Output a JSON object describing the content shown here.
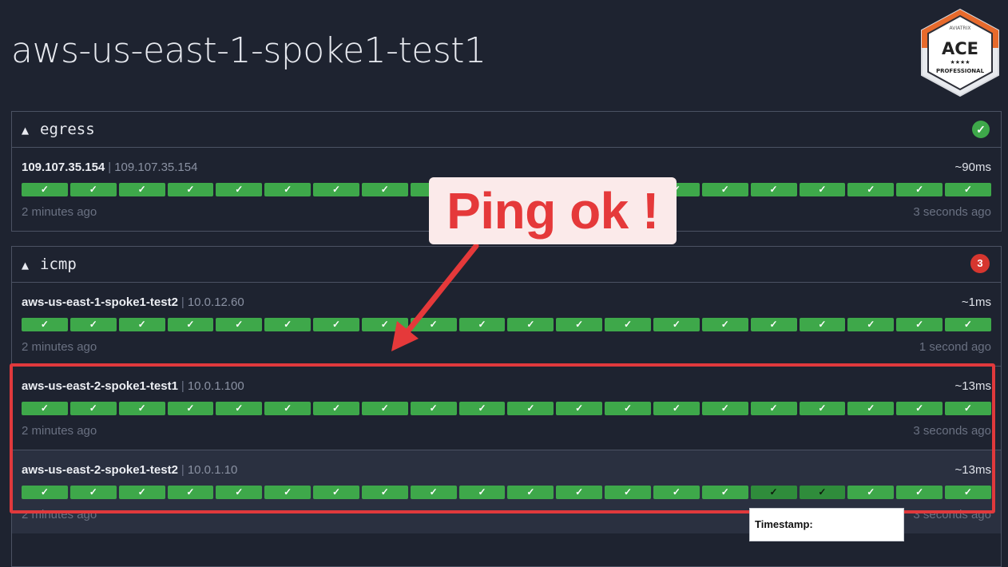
{
  "page": {
    "title": "aws-us-east-1-spoke1-test1"
  },
  "badge": {
    "brand": "AVIATRIX",
    "name": "ACE",
    "stars": "★★★★",
    "level": "PROFESSIONAL"
  },
  "groups": [
    {
      "name": "egress",
      "collapse_icon": "▲",
      "status": "ok",
      "status_icon": "check-circle-icon",
      "status_text": "✓",
      "rows": [
        {
          "name": "109.107.35.154",
          "ip": "109.107.35.154",
          "latency": "~90ms",
          "first_seen": "2 minutes ago",
          "last_seen": "3 seconds ago",
          "checks": [
            "ok",
            "ok",
            "ok",
            "ok",
            "ok",
            "ok",
            "ok",
            "ok",
            "ok",
            "ok",
            "ok",
            "ok",
            "ok",
            "ok",
            "ok",
            "ok",
            "ok",
            "ok",
            "ok",
            "ok"
          ]
        }
      ]
    },
    {
      "name": "icmp",
      "collapse_icon": "▲",
      "status": "count",
      "status_count": "3",
      "rows": [
        {
          "name": "aws-us-east-1-spoke1-test2",
          "ip": "10.0.12.60",
          "latency": "~1ms",
          "first_seen": "2 minutes ago",
          "last_seen": "1 second ago",
          "checks": [
            "ok",
            "ok",
            "ok",
            "ok",
            "ok",
            "ok",
            "ok",
            "ok",
            "ok",
            "ok",
            "ok",
            "ok",
            "ok",
            "ok",
            "ok",
            "ok",
            "ok",
            "ok",
            "ok",
            "ok"
          ]
        },
        {
          "name": "aws-us-east-2-spoke1-test1",
          "ip": "10.0.1.100",
          "latency": "~13ms",
          "first_seen": "2 minutes ago",
          "last_seen": "3 seconds ago",
          "checks": [
            "ok",
            "ok",
            "ok",
            "ok",
            "ok",
            "ok",
            "ok",
            "ok",
            "ok",
            "ok",
            "ok",
            "ok",
            "ok",
            "ok",
            "ok",
            "ok",
            "ok",
            "ok",
            "ok",
            "ok"
          ]
        },
        {
          "name": "aws-us-east-2-spoke1-test2",
          "ip": "10.0.1.10",
          "latency": "~13ms",
          "first_seen": "2 minutes ago",
          "last_seen": "3 seconds ago",
          "checks": [
            "ok",
            "ok",
            "ok",
            "ok",
            "ok",
            "ok",
            "ok",
            "ok",
            "ok",
            "ok",
            "ok",
            "ok",
            "ok",
            "ok",
            "ok",
            "ok",
            "ok",
            "ok",
            "ok",
            "ok"
          ]
        }
      ]
    }
  ],
  "annotation": {
    "text": "Ping ok !",
    "color": "#e5393a"
  },
  "tooltip": {
    "label": "Timestamp:"
  },
  "check_glyph": "✓",
  "colors": {
    "background": "#1e2330",
    "ok": "#3ea84a",
    "error": "#d6362f",
    "highlight": "#e0393c"
  }
}
